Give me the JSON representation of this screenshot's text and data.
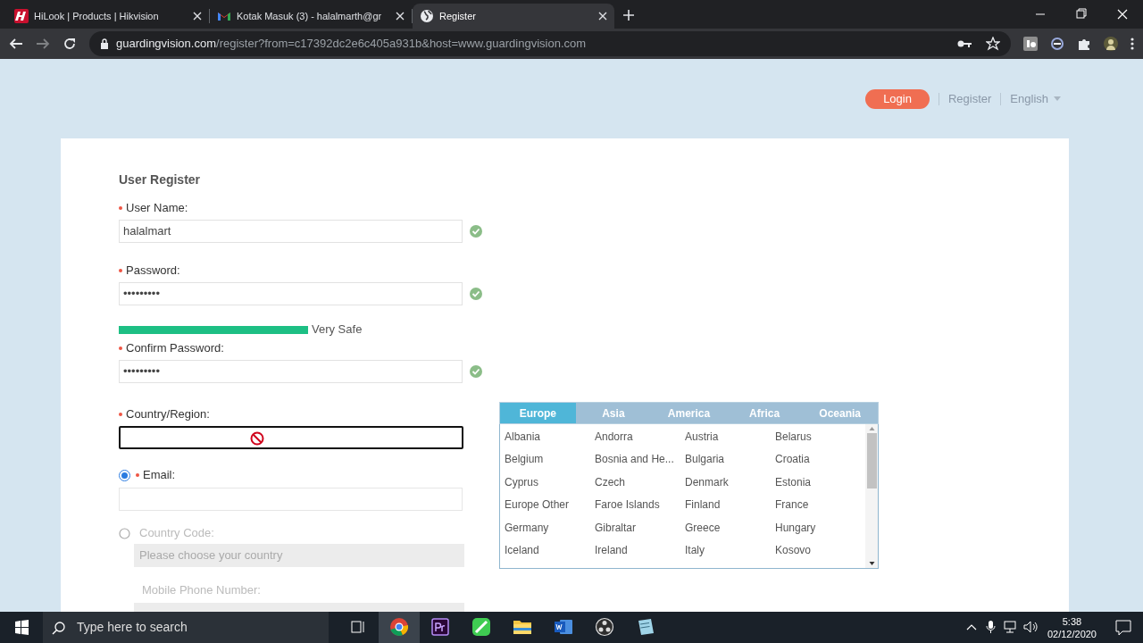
{
  "browser": {
    "tabs": [
      {
        "title": "HiLook | Products | Hikvision",
        "kind": "hilook",
        "selected": false
      },
      {
        "title": "Kotak Masuk (3) - halalmarth@gr",
        "kind": "gmail",
        "selected": false
      },
      {
        "title": "Register",
        "kind": "globe",
        "selected": true
      }
    ],
    "url_host": "guardingvision.com",
    "url_path": "/register?from=c17392dc2e6c405a931b&host=www.guardingvision.com"
  },
  "header": {
    "login": "Login",
    "register": "Register",
    "language": "English"
  },
  "form": {
    "title": "User Register",
    "username": {
      "label": "User Name:",
      "required": true,
      "value": "halalmart",
      "valid": true
    },
    "password": {
      "label": "Password:",
      "required": true,
      "value": "•••••••••",
      "valid": true
    },
    "strength": {
      "level": 1,
      "label": "Very Safe"
    },
    "confirm": {
      "label": "Confirm Password:",
      "required": true,
      "value": "•••••••••",
      "valid": true
    },
    "country": {
      "label": "Country/Region:",
      "required": true,
      "focused": true
    },
    "email": {
      "label": "Email:",
      "required": true,
      "selected": true
    },
    "country_code": {
      "label": "Country Code:",
      "selected": false,
      "placeholder": "Please choose your country"
    },
    "mobile": {
      "label": "Mobile Phone Number:"
    }
  },
  "region_picker": {
    "tabs": [
      {
        "label": "Europe",
        "selected": true
      },
      {
        "label": "Asia",
        "selected": false
      },
      {
        "label": "America",
        "selected": false
      },
      {
        "label": "Africa",
        "selected": false
      },
      {
        "label": "Oceania",
        "selected": false
      }
    ],
    "countries": [
      "Albania",
      "Andorra",
      "Austria",
      "Belarus",
      "Belgium",
      "Bosnia and He...",
      "Bulgaria",
      "Croatia",
      "Cyprus",
      "Czech",
      "Denmark",
      "Estonia",
      "Europe Other",
      "Faroe Islands",
      "Finland",
      "France",
      "Germany",
      "Gibraltar",
      "Greece",
      "Hungary",
      "Iceland",
      "Ireland",
      "Italy",
      "Kosovo"
    ]
  },
  "taskbar": {
    "search_placeholder": "Type here to search",
    "time": "5:38",
    "date": "02/12/2020"
  }
}
